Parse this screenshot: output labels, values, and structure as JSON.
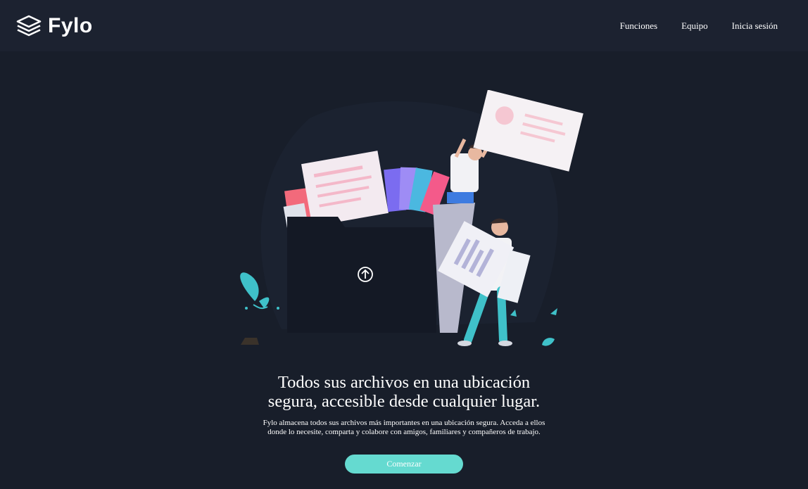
{
  "header": {
    "logo_text": "Fylo",
    "nav": [
      "Funciones",
      "Equipo",
      "Inicia sesión"
    ]
  },
  "hero": {
    "illustration": "people-uploading-files-into-folder-illustration",
    "headline_line1": "Todos sus archivos en una ubicación",
    "headline_line2": "segura, accesible desde cualquier lugar.",
    "subtext_line1": "Fylo almacena todos sus archivos más importantes en una ubicación segura. Acceda a ellos",
    "subtext_line2": "donde lo necesite, comparta y colabore con amigos, familiares y compañeros de trabajo.",
    "cta_label": "Comenzar"
  },
  "colors": {
    "page_bg": "#181e2a",
    "header_bg": "#1c2230",
    "accent": "#65dad0",
    "text": "#ffffff"
  },
  "icons": [
    "logo-layers-icon",
    "upload-arrow-icon",
    "leaf-icon"
  ]
}
